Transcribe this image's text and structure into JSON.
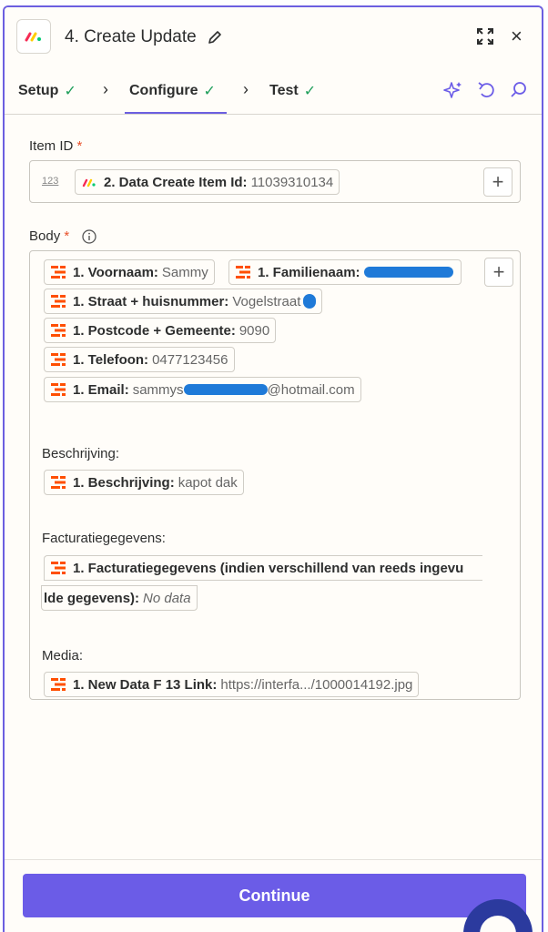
{
  "header": {
    "title": "4. Create Update",
    "app_icon": "monday-logo-icon"
  },
  "tabs": [
    {
      "label": "Setup",
      "done": true
    },
    {
      "label": "Configure",
      "done": true,
      "active": true
    },
    {
      "label": "Test",
      "done": true
    }
  ],
  "item_id": {
    "label": "Item ID",
    "required": "*",
    "type_hint": "123",
    "pill_key": "2. Data Create Item Id:",
    "pill_value": "11039310134"
  },
  "body": {
    "label": "Body",
    "required": "*",
    "pills": [
      {
        "key": "1. Voornaam:",
        "value": "Sammy"
      },
      {
        "key": "1. Familienaam:",
        "value": ""
      },
      {
        "key": "1. Straat + huisnummer:",
        "value": "Vogelstraat"
      },
      {
        "key": "1. Postcode + Gemeente:",
        "value": "9090"
      },
      {
        "key": "1. Telefoon:",
        "value": "0477123456"
      },
      {
        "key": "1. Email:",
        "value_prefix": "sammys",
        "value_suffix": "@hotmail.com"
      }
    ],
    "beschrijving_label": "Beschrijving:",
    "beschrijving_pill": {
      "key": "1. Beschrijving:",
      "value": "kapot dak"
    },
    "facturatie_label": "Facturatiegegevens:",
    "facturatie_pill_line1": "1. Facturatiegegevens (indien verschillend van reeds ingevu",
    "facturatie_pill_line2_key": "lde gegevens):",
    "facturatie_pill_line2_value": "No data",
    "media_label": "Media:",
    "media_pill": {
      "key": "1. New Data F 13 Link:",
      "value": "https://interfa.../1000014192.jpg"
    }
  },
  "footer": {
    "continue_label": "Continue"
  },
  "colors": {
    "accent": "#6b5ce7",
    "check": "#1e9e5a",
    "required": "#e8502a",
    "zapier_orange": "#ff4f00",
    "redaction": "#1f7ad8"
  }
}
